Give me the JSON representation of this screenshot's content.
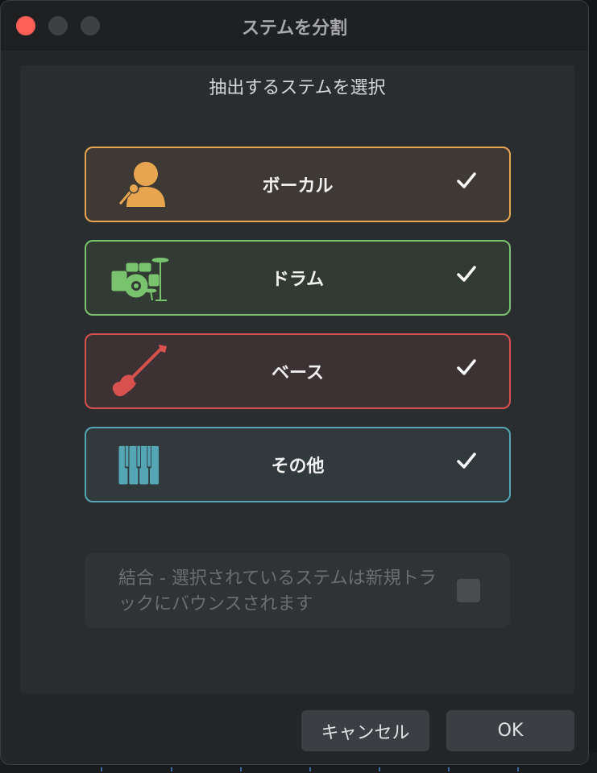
{
  "window": {
    "title": "ステムを分割"
  },
  "panel": {
    "heading": "抽出するステムを選択"
  },
  "stems": [
    {
      "label": "ボーカル",
      "icon": "microphone-singer-icon",
      "color": "#e6a54e",
      "checked": true
    },
    {
      "label": "ドラム",
      "icon": "drum-kit-icon",
      "color": "#79c36f",
      "checked": true
    },
    {
      "label": "ベース",
      "icon": "bass-guitar-icon",
      "color": "#d9514f",
      "checked": true
    },
    {
      "label": "その他",
      "icon": "piano-keys-icon",
      "color": "#55a6b4",
      "checked": true
    }
  ],
  "combine": {
    "text": "結合 - 選択されているステムは新規トラックにバウンスされます",
    "checked": false,
    "enabled": false
  },
  "buttons": {
    "cancel": "キャンセル",
    "ok": "OK"
  }
}
